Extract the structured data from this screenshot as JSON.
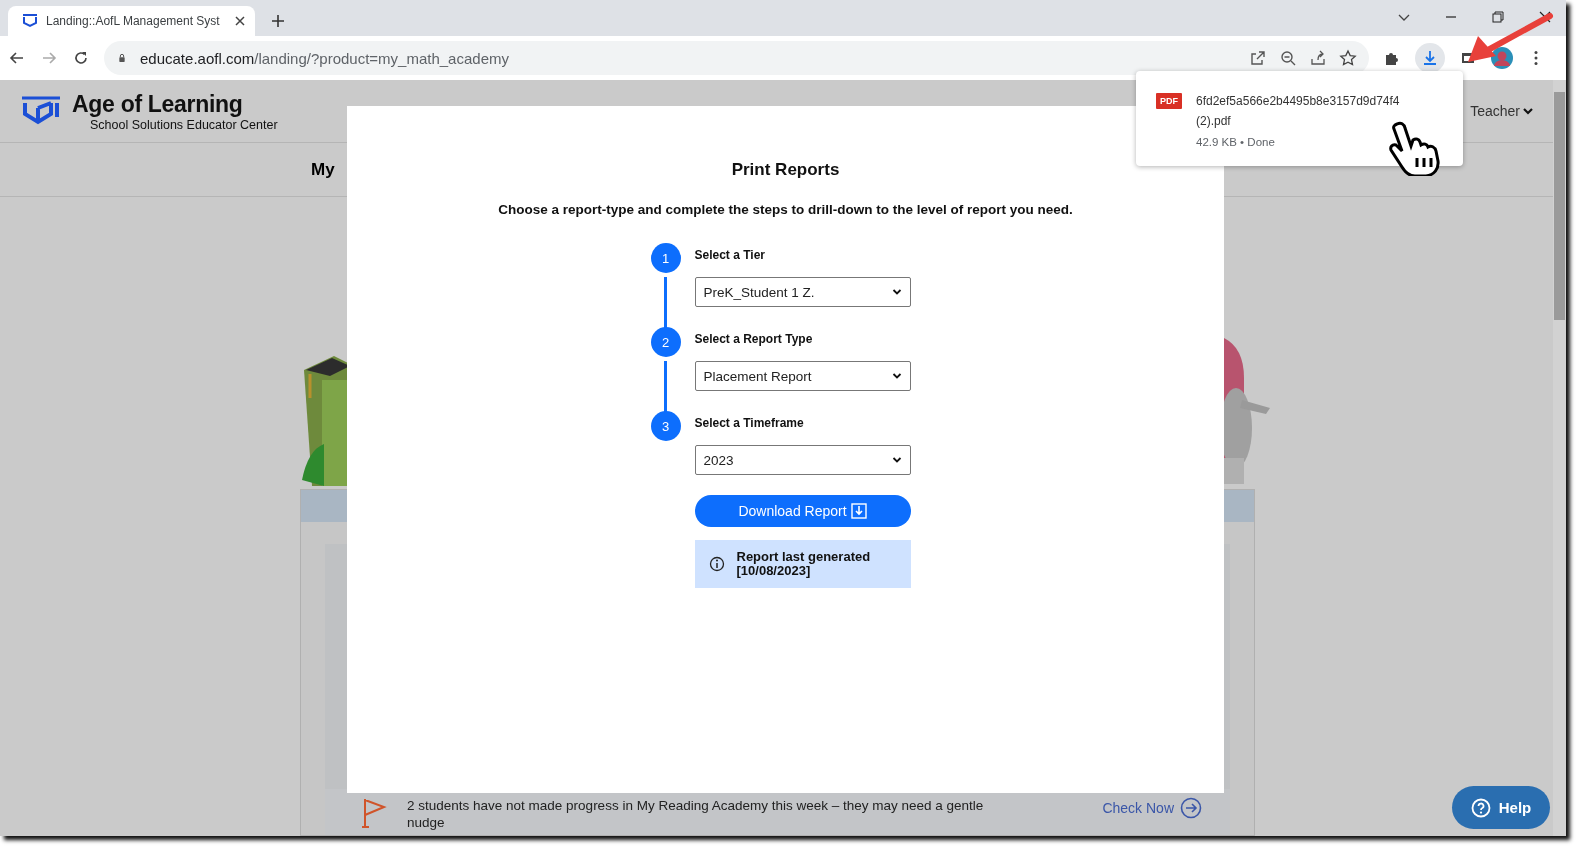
{
  "browser": {
    "tabs": [
      {
        "title": "Landing::AofL Management Syst",
        "selected": true
      }
    ],
    "url": {
      "domain": "educate.aofl.com",
      "path": "/landing/?product=my_math_academy"
    },
    "downloads_active": true
  },
  "header": {
    "brand": "Age of Learning",
    "tagline": "School Solutions Educator Center",
    "user_menu": "Teacher"
  },
  "nav": {
    "label": "My"
  },
  "notice": {
    "text": "2 students have not made progress in My Reading Academy this week – they may need a gentle nudge",
    "link": "Check Now"
  },
  "help_button": "Help",
  "modal": {
    "title": "Print Reports",
    "instructions": "Choose a report-type and complete the steps to drill-down to the level of report you need.",
    "steps": [
      {
        "number": "1",
        "label": "Select a Tier",
        "value": "PreK_Student 1 Z."
      },
      {
        "number": "2",
        "label": "Select a Report Type",
        "value": "Placement Report"
      },
      {
        "number": "3",
        "label": "Select a Timeframe",
        "value": "2023"
      }
    ],
    "download_button": "Download Report",
    "info": "Report last generated [10/08/2023]"
  },
  "download_popup": {
    "file_icon": "PDF",
    "filename": "6fd2ef5a566e2b4495b8e3157d9d74f4 (2).pdf",
    "status": "42.9 KB • Done"
  }
}
